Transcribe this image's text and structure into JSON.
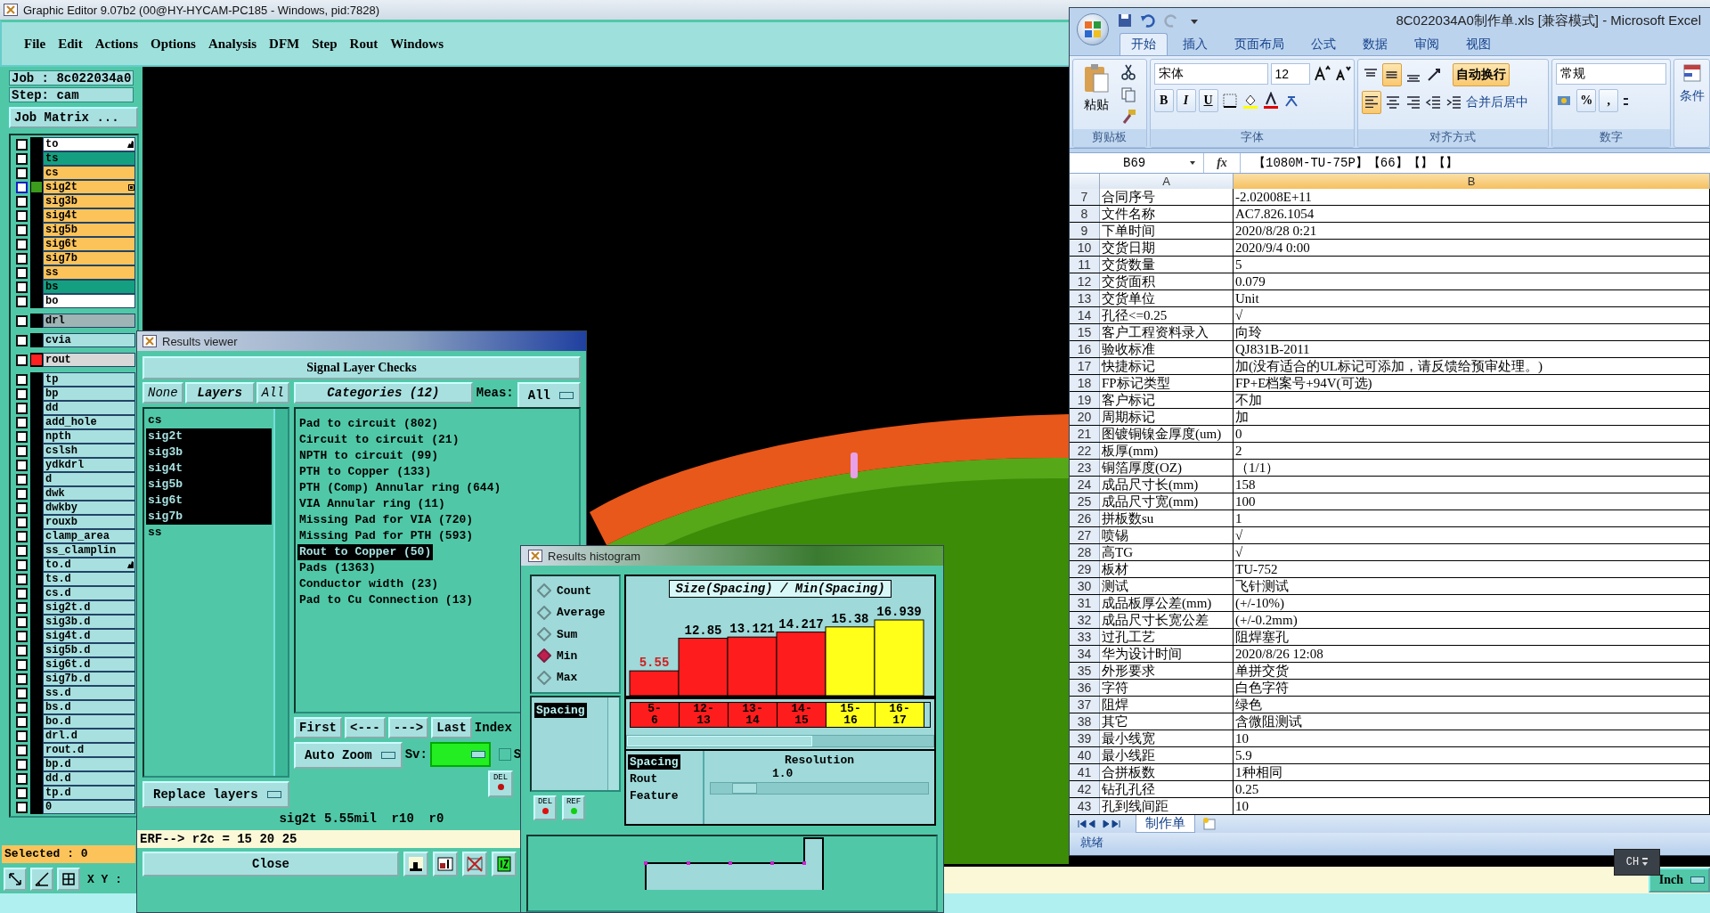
{
  "main_window": {
    "title": "Graphic Editor 9.07b2 (00@HY-HYCAM-PC185 - Windows, pid:7828)",
    "menu": [
      "File",
      "Edit",
      "Actions",
      "Options",
      "Analysis",
      "DFM",
      "Step",
      "Rout",
      "Windows"
    ],
    "job": "Job : 8c022034a0",
    "step": "Step: cam",
    "job_matrix_button": "Job Matrix ...",
    "layer_groups": [
      {
        "layers": [
          {
            "name": "to",
            "color": "#ffffff",
            "checked": false,
            "active": false,
            "tagged": true
          },
          {
            "name": "ts",
            "color": "#14a080",
            "checked": false,
            "active": false,
            "tagged": false
          },
          {
            "name": "cs",
            "color": "#fbc35a",
            "checked": false,
            "active": false,
            "tagged": false
          },
          {
            "name": "sig2t",
            "color": "#fbc35a",
            "checked": false,
            "active": true,
            "tagged": false,
            "marker": {
              "color": "#3c9a1c"
            }
          },
          {
            "name": "sig3b",
            "color": "#fbc35a",
            "checked": false,
            "active": false,
            "tagged": false
          },
          {
            "name": "sig4t",
            "color": "#fbc35a",
            "checked": false,
            "active": false,
            "tagged": false
          },
          {
            "name": "sig5b",
            "color": "#fbc35a",
            "checked": false,
            "active": false,
            "tagged": false
          },
          {
            "name": "sig6t",
            "color": "#fbc35a",
            "checked": false,
            "active": false,
            "tagged": false
          },
          {
            "name": "sig7b",
            "color": "#fbc35a",
            "checked": false,
            "active": false,
            "tagged": false
          },
          {
            "name": "ss",
            "color": "#fbc35a",
            "checked": false,
            "active": false,
            "tagged": false
          },
          {
            "name": "bs",
            "color": "#14a080",
            "checked": false,
            "active": false,
            "tagged": false
          },
          {
            "name": "bo",
            "color": "#ffffff",
            "checked": false,
            "active": false,
            "tagged": false
          }
        ]
      },
      {
        "layers": [
          {
            "name": "drl",
            "color": "#9fb4b4",
            "checked": false,
            "active": false,
            "tagged": false
          }
        ]
      },
      {
        "layers": [
          {
            "name": "cvia",
            "color": "#a8e0e0",
            "checked": false,
            "active": false,
            "tagged": false
          }
        ]
      },
      {
        "layers": [
          {
            "name": "rout",
            "color": "#d8d8d8",
            "checked": false,
            "active": false,
            "tagged": false,
            "marker": {
              "color": "#ff2020"
            }
          }
        ]
      },
      {
        "layers": [
          {
            "name": "tp",
            "color": "#a8e0e0",
            "checked": false,
            "active": false,
            "tagged": false
          },
          {
            "name": "bp",
            "color": "#a8e0e0",
            "checked": false,
            "active": false,
            "tagged": false
          },
          {
            "name": "dd",
            "color": "#a8e0e0",
            "checked": false,
            "active": false,
            "tagged": false
          },
          {
            "name": "add_hole",
            "color": "#a8e0e0",
            "checked": false,
            "active": false,
            "tagged": false
          },
          {
            "name": "npth",
            "color": "#a8e0e0",
            "checked": false,
            "active": false,
            "tagged": false
          },
          {
            "name": "cslsh",
            "color": "#a8e0e0",
            "checked": false,
            "active": false,
            "tagged": false
          },
          {
            "name": "ydkdrl",
            "color": "#a8e0e0",
            "checked": false,
            "active": false,
            "tagged": false
          },
          {
            "name": "d",
            "color": "#a8e0e0",
            "checked": false,
            "active": false,
            "tagged": false
          },
          {
            "name": "dwk",
            "color": "#a8e0e0",
            "checked": false,
            "active": false,
            "tagged": false
          },
          {
            "name": "dwkby",
            "color": "#a8e0e0",
            "checked": false,
            "active": false,
            "tagged": false
          },
          {
            "name": "rouxb",
            "color": "#a8e0e0",
            "checked": false,
            "active": false,
            "tagged": false
          },
          {
            "name": "clamp_area",
            "color": "#a8e0e0",
            "checked": false,
            "active": false,
            "tagged": false
          },
          {
            "name": "ss_clamplin",
            "color": "#a8e0e0",
            "checked": false,
            "active": false,
            "tagged": false
          },
          {
            "name": "to.d",
            "color": "#a8e0e0",
            "checked": false,
            "active": false,
            "tagged": true
          },
          {
            "name": "ts.d",
            "color": "#a8e0e0",
            "checked": false,
            "active": false,
            "tagged": false
          },
          {
            "name": "cs.d",
            "color": "#a8e0e0",
            "checked": false,
            "active": false,
            "tagged": false
          },
          {
            "name": "sig2t.d",
            "color": "#a8e0e0",
            "checked": false,
            "active": false,
            "tagged": false
          },
          {
            "name": "sig3b.d",
            "color": "#a8e0e0",
            "checked": false,
            "active": false,
            "tagged": false
          },
          {
            "name": "sig4t.d",
            "color": "#a8e0e0",
            "checked": false,
            "active": false,
            "tagged": false
          },
          {
            "name": "sig5b.d",
            "color": "#a8e0e0",
            "checked": false,
            "active": false,
            "tagged": false
          },
          {
            "name": "sig6t.d",
            "color": "#a8e0e0",
            "checked": false,
            "active": false,
            "tagged": false
          },
          {
            "name": "sig7b.d",
            "color": "#a8e0e0",
            "checked": false,
            "active": false,
            "tagged": false
          },
          {
            "name": "ss.d",
            "color": "#a8e0e0",
            "checked": false,
            "active": false,
            "tagged": false
          },
          {
            "name": "bs.d",
            "color": "#a8e0e0",
            "checked": false,
            "active": false,
            "tagged": false
          },
          {
            "name": "bo.d",
            "color": "#a8e0e0",
            "checked": false,
            "active": false,
            "tagged": false
          },
          {
            "name": "drl.d",
            "color": "#a8e0e0",
            "checked": false,
            "active": false,
            "tagged": false
          },
          {
            "name": "rout.d",
            "color": "#a8e0e0",
            "checked": false,
            "active": false,
            "tagged": false
          },
          {
            "name": "bp.d",
            "color": "#a8e0e0",
            "checked": false,
            "active": false,
            "tagged": false
          },
          {
            "name": "dd.d",
            "color": "#a8e0e0",
            "checked": false,
            "active": false,
            "tagged": false
          },
          {
            "name": "tp.d",
            "color": "#a8e0e0",
            "checked": false,
            "active": false,
            "tagged": false
          },
          {
            "name": "0",
            "color": "#a8e0e0",
            "checked": false,
            "active": false,
            "tagged": false
          }
        ]
      }
    ],
    "selected_label": "Selected : 0",
    "coord_label": "X Y :",
    "units": "Inch",
    "ime": "CH"
  },
  "results_viewer": {
    "title": "Results viewer",
    "header": "Signal Layer Checks",
    "layer_buttons": [
      {
        "label": "None",
        "selected": false
      },
      {
        "label": "Layers",
        "selected": true
      },
      {
        "label": "All",
        "selected": false
      }
    ],
    "layers": [
      {
        "name": "cs",
        "selected": false
      },
      {
        "name": "sig2t",
        "selected": true
      },
      {
        "name": "sig3b",
        "selected": true
      },
      {
        "name": "sig4t",
        "selected": true
      },
      {
        "name": "sig5b",
        "selected": true
      },
      {
        "name": "sig6t",
        "selected": true
      },
      {
        "name": "sig7b",
        "selected": true
      },
      {
        "name": "ss",
        "selected": false
      }
    ],
    "categories_button": "Categories (12)",
    "meas_label": "Meas:",
    "meas_value": "All",
    "categories": [
      {
        "label": "Pad to circuit (802)",
        "selected": false
      },
      {
        "label": "Circuit to circuit (21)",
        "selected": false
      },
      {
        "label": "NPTH to circuit (99)",
        "selected": false
      },
      {
        "label": "PTH to Copper (133)",
        "selected": false
      },
      {
        "label": "PTH (Comp) Annular ring (644)",
        "selected": false
      },
      {
        "label": "VIA Annular ring (11)",
        "selected": false
      },
      {
        "label": "Missing Pad for VIA (720)",
        "selected": false
      },
      {
        "label": "Missing Pad for PTH (593)",
        "selected": false
      },
      {
        "label": "Rout to Copper (50)",
        "selected": true
      },
      {
        "label": "Pads (1363)",
        "selected": false
      },
      {
        "label": "Conductor width (23)",
        "selected": false
      },
      {
        "label": "Pad to Cu Connection (13)",
        "selected": false
      }
    ],
    "nav_buttons": [
      "First",
      "<---",
      "--->",
      "Last"
    ],
    "index_label": "Index",
    "zoom_mode": "Auto Zoom",
    "sv_label": "Sv:",
    "show_checkbox": {
      "label": "S",
      "checked": false
    },
    "replace_button": "Replace layers",
    "del_button": "DEL",
    "status": "sig2t 5.55mil  r10  r0",
    "command": "ERF--> r2c = 15 20 25",
    "close_button": "Close"
  },
  "results_histogram": {
    "title": "Results histogram",
    "modes": [
      {
        "label": "Count",
        "selected": false
      },
      {
        "label": "Average",
        "selected": false
      },
      {
        "label": "Sum",
        "selected": false
      },
      {
        "label": "Min",
        "selected": true
      },
      {
        "label": "Max",
        "selected": false
      }
    ],
    "measures": [
      {
        "label": "Spacing",
        "selected": true
      }
    ],
    "del_button": "DEL",
    "ref_button": "REF",
    "chart_data": {
      "type": "bar",
      "title": "Size(Spacing) / Min(Spacing)",
      "categories": [
        "5-6",
        "12-13",
        "13-14",
        "14-15",
        "15-16",
        "16-17"
      ],
      "series": [
        {
          "color": "#ff1c1c",
          "values": [
            5.55,
            12.85,
            13.121,
            14.217,
            null,
            null
          ]
        },
        {
          "color": "#ffff1a",
          "values": [
            null,
            null,
            null,
            null,
            15.38,
            16.939
          ]
        }
      ],
      "data_labels": true
    },
    "fields": [
      {
        "label": "Spacing",
        "selected": true
      },
      {
        "label": "Rout",
        "selected": false
      },
      {
        "label": "Feature",
        "selected": false
      }
    ],
    "resolution_label": "Resolution",
    "resolution_value": "1.0",
    "resolution_slider": {
      "level": 0.1
    }
  },
  "excel": {
    "title": "8C022034A0制作单.xls  [兼容模式] - Microsoft Excel",
    "ribbon_tabs": [
      {
        "label": "开始",
        "selected": true
      },
      {
        "label": "插入",
        "selected": false
      },
      {
        "label": "页面布局",
        "selected": false
      },
      {
        "label": "公式",
        "selected": false
      },
      {
        "label": "数据",
        "selected": false
      },
      {
        "label": "审阅",
        "selected": false
      },
      {
        "label": "视图",
        "selected": false
      }
    ],
    "paste_label": "粘贴",
    "font_name": "宋体",
    "font_size": "12",
    "format_buttons": [
      "B",
      "I",
      "U"
    ],
    "wrap_text": "自动换行",
    "merge_center": "合并后居中",
    "number_format": "常规",
    "number_buttons": [
      "%",
      ","
    ],
    "conditional": "条件",
    "ribbon_groups": [
      "剪贴板",
      "字体",
      "对齐方式",
      "数字"
    ],
    "name_box": "B69",
    "fx_label": "fx",
    "formula": "【1080M-TU-75P】【66】【】【】",
    "columns": [
      "A",
      "B"
    ],
    "rows": [
      {
        "number": "7",
        "a": "合同序号",
        "b": "-2.02008E+11"
      },
      {
        "number": "8",
        "a": "文件名称",
        "b": "AC7.826.1054"
      },
      {
        "number": "9",
        "a": "下单时间",
        "b": "2020/8/28 0:21"
      },
      {
        "number": "10",
        "a": "交货日期",
        "b": "2020/9/4 0:00"
      },
      {
        "number": "11",
        "a": "交货数量",
        "b": "5"
      },
      {
        "number": "12",
        "a": "交货面积",
        "b": "0.079"
      },
      {
        "number": "13",
        "a": "交货单位",
        "b": "Unit"
      },
      {
        "number": "14",
        "a": "孔径<=0.25",
        "b": "√"
      },
      {
        "number": "15",
        "a": "客户工程资料录入",
        "b": "向玲"
      },
      {
        "number": "16",
        "a": "验收标准",
        "b": "QJ831B-2011"
      },
      {
        "number": "17",
        "a": "快捷标记",
        "b": "加(没有适合的UL标记可添加，请反馈给预审处理。)"
      },
      {
        "number": "18",
        "a": "FP标记类型",
        "b": "FP+E档案号+94V(可选)"
      },
      {
        "number": "19",
        "a": "客户标记",
        "b": "不加"
      },
      {
        "number": "20",
        "a": "周期标记",
        "b": "加"
      },
      {
        "number": "21",
        "a": "图镀铜镍金厚度(um)",
        "b": "0"
      },
      {
        "number": "22",
        "a": "板厚(mm)",
        "b": "2"
      },
      {
        "number": "23",
        "a": "铜箔厚度(OZ)",
        "b": "（1/1）"
      },
      {
        "number": "24",
        "a": "成品尺寸长(mm)",
        "b": "158"
      },
      {
        "number": "25",
        "a": "成品尺寸宽(mm)",
        "b": "100"
      },
      {
        "number": "26",
        "a": "拼板数su",
        "b": "1"
      },
      {
        "number": "27",
        "a": "喷锡",
        "b": "√"
      },
      {
        "number": "28",
        "a": "高TG",
        "b": "√"
      },
      {
        "number": "29",
        "a": "板材",
        "b": "TU-752"
      },
      {
        "number": "30",
        "a": "测试",
        "b": "飞针测试"
      },
      {
        "number": "31",
        "a": "成品板厚公差(mm)",
        "b": "(+/-10%)"
      },
      {
        "number": "32",
        "a": "成品尺寸长宽公差",
        "b": "(+/-0.2mm)"
      },
      {
        "number": "33",
        "a": "过孔工艺",
        "b": "阻焊塞孔"
      },
      {
        "number": "34",
        "a": "华为设计时间",
        "b": "2020/8/26 12:08"
      },
      {
        "number": "35",
        "a": "外形要求",
        "b": "单拼交货"
      },
      {
        "number": "36",
        "a": "字符",
        "b": "白色字符"
      },
      {
        "number": "37",
        "a": "阻焊",
        "b": "绿色"
      },
      {
        "number": "38",
        "a": "其它",
        "b": "含微阻测试"
      },
      {
        "number": "39",
        "a": "最小线宽",
        "b": "10"
      },
      {
        "number": "40",
        "a": "最小线距",
        "b": "5.9"
      },
      {
        "number": "41",
        "a": "合拼板数",
        "b": "1种相同"
      },
      {
        "number": "42",
        "a": "钻孔孔径",
        "b": "0.25"
      },
      {
        "number": "43",
        "a": "孔到线间距",
        "b": "10"
      }
    ],
    "sheet_tabs": [
      {
        "label": "制作单",
        "selected": true
      }
    ],
    "status": "就绪"
  }
}
